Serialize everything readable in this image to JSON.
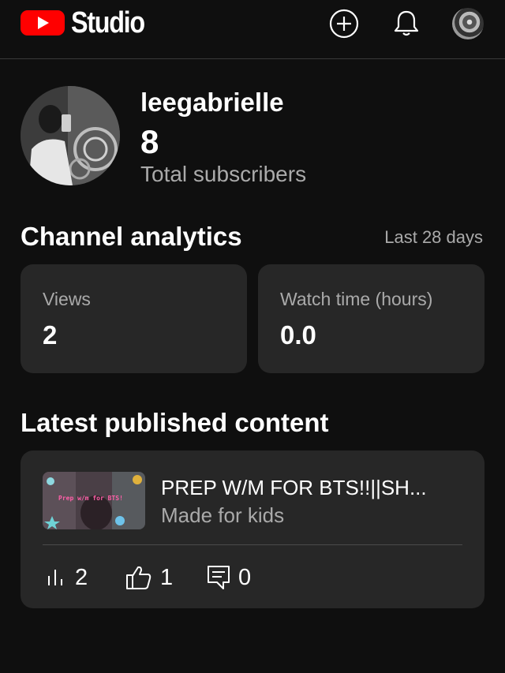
{
  "header": {
    "app_name": "Studio",
    "logo_icon": "youtube-play-logo",
    "brand_color": "#ff0000",
    "icons": [
      "create-plus-icon",
      "notifications-bell-icon"
    ]
  },
  "profile": {
    "channel_name": "leegabrielle",
    "subscriber_count": "8",
    "subscriber_label": "Total subscribers"
  },
  "analytics": {
    "title": "Channel analytics",
    "period": "Last 28 days",
    "views": {
      "label": "Views",
      "value": "2"
    },
    "watch_time": {
      "label": "Watch time (hours)",
      "value": "0.0"
    }
  },
  "latest": {
    "title": "Latest published content",
    "video": {
      "title": "PREP W/M FOR BTS!!||SH...",
      "subtitle": "Made for kids",
      "thumb_text": "Prep w/m for BTS!",
      "views": "2",
      "likes": "1",
      "comments": "0"
    }
  }
}
